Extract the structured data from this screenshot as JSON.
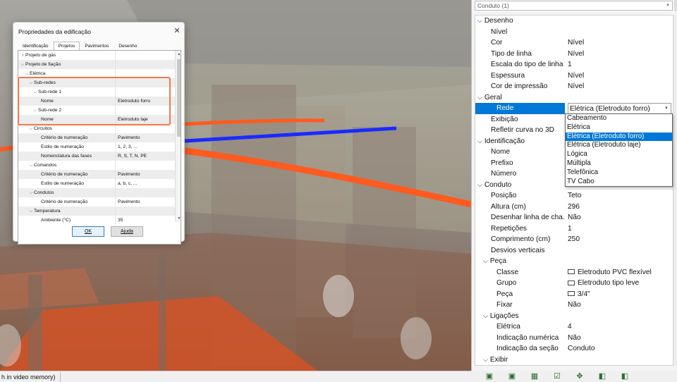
{
  "dialog": {
    "title": "Propriedades da edificação",
    "close": "✕",
    "tabs": [
      "Identificação",
      "Projetos",
      "Pavimentos",
      "Desenho"
    ],
    "rows": [
      {
        "chev": ">",
        "name": "Projeto de gás",
        "value": ""
      },
      {
        "chev": "v",
        "name": "Projeto de fiação",
        "value": ""
      },
      {
        "chev": "v",
        "name": "Elétrica",
        "value": ""
      },
      {
        "chev": "v",
        "name": "Sub-redes",
        "value": ""
      },
      {
        "chev": "v",
        "name": "Sub-rede 1",
        "value": ""
      },
      {
        "chev": "",
        "name": "Nome",
        "value": "Eletroduto forro"
      },
      {
        "chev": "v",
        "name": "Sub-rede 2",
        "value": ""
      },
      {
        "chev": "",
        "name": "Nome",
        "value": "Eletroduto laje"
      },
      {
        "chev": "v",
        "name": "Circuitos",
        "value": ""
      },
      {
        "chev": "",
        "name": "Critério de numeração",
        "value": "Pavimento"
      },
      {
        "chev": "",
        "name": "Estilo de numeração",
        "value": "1, 2, 3, ..."
      },
      {
        "chev": "",
        "name": "Nomenclatura das fases",
        "value": "R, S, T, N, PE"
      },
      {
        "chev": "v",
        "name": "Comandos",
        "value": ""
      },
      {
        "chev": "",
        "name": "Critério de numeração",
        "value": "Pavimento"
      },
      {
        "chev": "",
        "name": "Estilo de numeração",
        "value": "a, b, c, ..."
      },
      {
        "chev": "v",
        "name": "Condutos",
        "value": ""
      },
      {
        "chev": "",
        "name": "Critério de numeração",
        "value": "Pavimento"
      },
      {
        "chev": "v",
        "name": "Temperatura",
        "value": ""
      },
      {
        "chev": "",
        "name": "Ambiente (°C)",
        "value": "35"
      }
    ],
    "ok_label": "OK",
    "help_label": "Ajuda"
  },
  "status": {
    "text": "h in video memory)"
  },
  "panel": {
    "selector": "Conduto (1)",
    "rows": [
      {
        "type": "cat",
        "chev": "v",
        "name": "Desenho",
        "value": ""
      },
      {
        "type": "prop",
        "name": "Nível",
        "value": ""
      },
      {
        "type": "prop",
        "name": "Cor",
        "value": "Nível"
      },
      {
        "type": "prop",
        "name": "Tipo de linha",
        "value": "Nível"
      },
      {
        "type": "prop",
        "name": "Escala do tipo de linha",
        "value": "1"
      },
      {
        "type": "prop",
        "name": "Espessura",
        "value": "Nível"
      },
      {
        "type": "prop",
        "name": "Cor de impressão",
        "value": "Nível"
      },
      {
        "type": "cat",
        "chev": "v",
        "name": "Geral",
        "value": ""
      },
      {
        "type": "sel",
        "name": "Rede",
        "value": "Elétrica (Eletroduto forro)"
      },
      {
        "type": "prop",
        "name": "Exibição",
        "value": ""
      },
      {
        "type": "prop",
        "name": "Refletir curva no 3D",
        "value": ""
      },
      {
        "type": "cat",
        "chev": "v",
        "name": "Identificação",
        "value": ""
      },
      {
        "type": "prop",
        "name": "Nome",
        "value": ""
      },
      {
        "type": "prop",
        "name": "Prefixo",
        "value": ""
      },
      {
        "type": "prop",
        "name": "Número",
        "value": ""
      },
      {
        "type": "cat",
        "chev": "v",
        "name": "Conduto",
        "value": ""
      },
      {
        "type": "prop",
        "name": "Posição",
        "value": "Teto"
      },
      {
        "type": "prop",
        "name": "Altura (cm)",
        "value": "296"
      },
      {
        "type": "prop",
        "name": "Desenhar linha de cha...",
        "value": "Não"
      },
      {
        "type": "prop",
        "name": "Repetições",
        "value": "1"
      },
      {
        "type": "prop",
        "name": "Comprimento (cm)",
        "value": "250"
      },
      {
        "type": "prop",
        "name": "Desvios verticais",
        "value": ""
      },
      {
        "type": "cat2",
        "chev": "v",
        "name": "Peça",
        "value": ""
      },
      {
        "type": "prop2",
        "name": "Classe",
        "value": "Eletroduto PVC flexível",
        "icon": "folder-icon"
      },
      {
        "type": "prop2",
        "name": "Grupo",
        "value": "Eletroduto tipo leve",
        "icon": "box-icon"
      },
      {
        "type": "prop2",
        "name": "Peça",
        "value": "3/4\"",
        "icon": "box-icon"
      },
      {
        "type": "prop2",
        "name": "Fixar",
        "value": "Não"
      },
      {
        "type": "cat2",
        "chev": "v",
        "name": "Ligações",
        "value": ""
      },
      {
        "type": "prop2",
        "name": "Elétrica",
        "value": "4"
      },
      {
        "type": "prop2",
        "name": "Indicação numérica",
        "value": "Não"
      },
      {
        "type": "prop2",
        "name": "Indicação da seção",
        "value": "Conduto"
      },
      {
        "type": "cat2",
        "chev": "v",
        "name": "Exibir",
        "value": ""
      }
    ],
    "dropdown_options": [
      "Cabeamento",
      "Elétrica",
      "Elétrica (Eletroduto forro)",
      "Elétrica (Eletroduto laje)",
      "Lógica",
      "Múltipla",
      "Telefônica",
      "TV Cabo"
    ],
    "dropdown_selected": 2,
    "toolbar_icons": [
      "view-icon",
      "view-icon",
      "grid-icon",
      "check-icon",
      "tool-icon",
      "layers-icon",
      "layers-icon"
    ],
    "colors": {
      "accent": "#0078d7",
      "highlight": "#f07a4a",
      "pipe_orange": "#ff5a1f",
      "pipe_blue": "#1a2bff"
    }
  }
}
